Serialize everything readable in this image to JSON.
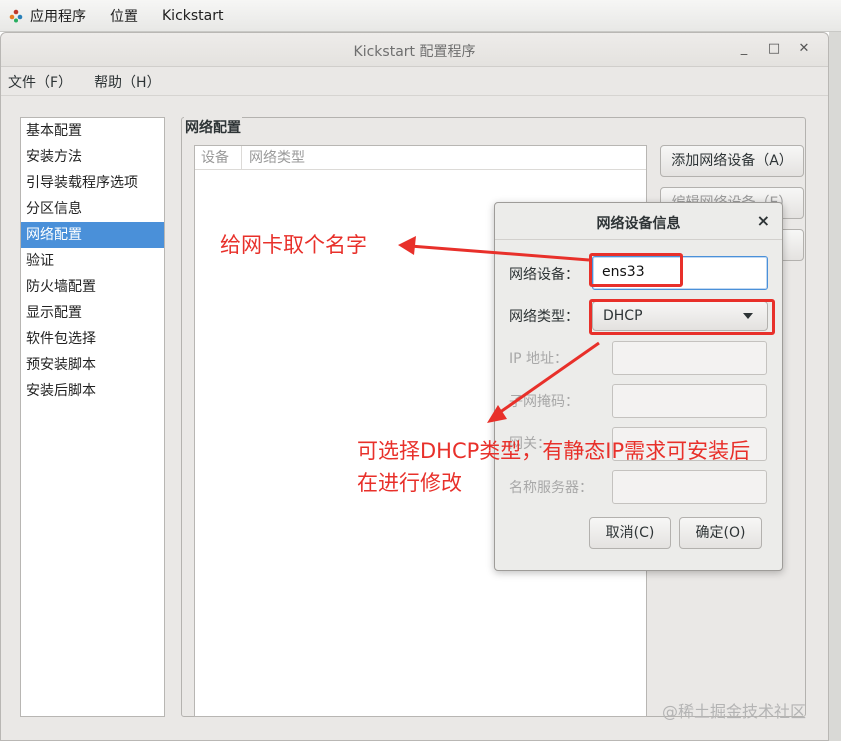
{
  "topbar": {
    "apps": "应用程序",
    "places": "位置",
    "app_name": "Kickstart"
  },
  "window": {
    "title": "Kickstart 配置程序",
    "minimize": "_",
    "maximize": "□",
    "close": "✕"
  },
  "menu": {
    "file": "文件（F）",
    "help": "帮助（H）"
  },
  "sidebar": {
    "items": [
      {
        "label": "基本配置"
      },
      {
        "label": "安装方法"
      },
      {
        "label": "引导装载程序选项"
      },
      {
        "label": "分区信息"
      },
      {
        "label": "网络配置",
        "selected": true
      },
      {
        "label": "验证"
      },
      {
        "label": "防火墙配置"
      },
      {
        "label": "显示配置"
      },
      {
        "label": "软件包选择"
      },
      {
        "label": "预安装脚本"
      },
      {
        "label": "安装后脚本"
      }
    ]
  },
  "network": {
    "section_title": "网络配置",
    "columns": [
      "设备",
      "网络类型"
    ],
    "add_button": "添加网络设备（A）",
    "edit_button": "编辑网络设备（E）"
  },
  "dialog": {
    "title": "网络设备信息",
    "close": "×",
    "device_label": "网络设备：",
    "device_value": "ens33",
    "type_label": "网络类型：",
    "type_value": "DHCP",
    "ip_label": "IP 地址：",
    "netmask_label": "子网掩码：",
    "gateway_label": "网关：",
    "dns_label": "名称服务器：",
    "cancel": "取消(C)",
    "ok": "确定(O)"
  },
  "annotations": {
    "name_note": "给网卡取个名字",
    "type_note_line1": "可选择DHCP类型，有静态IP需求可安装后",
    "type_note_line2": "在进行修改",
    "color": "#e8302a"
  },
  "watermark": "@稀土掘金技术社区"
}
